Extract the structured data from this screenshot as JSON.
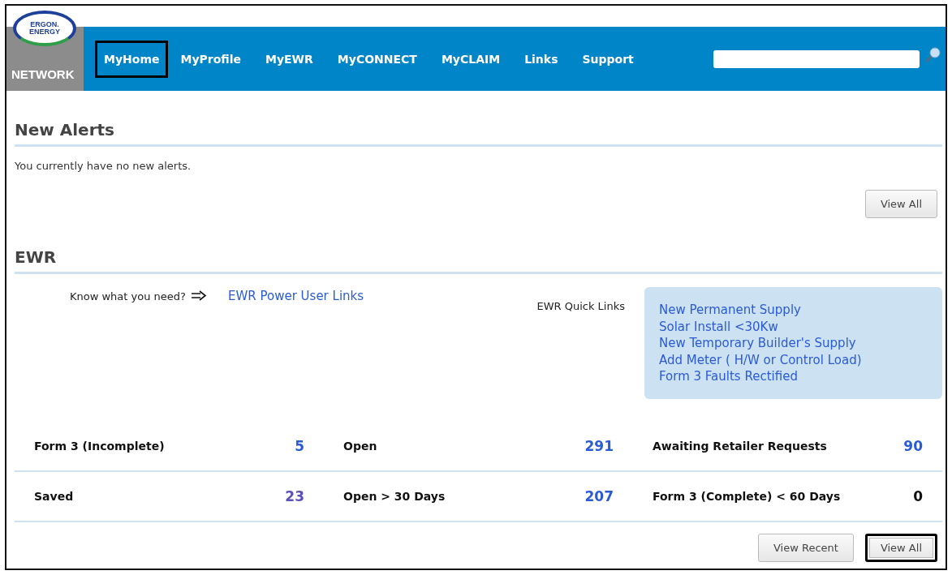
{
  "logo": {
    "lines": [
      "ERGON.",
      "ENERGY"
    ],
    "caption": "NETWORK"
  },
  "nav": [
    {
      "label": "MyHome",
      "highlighted": true
    },
    {
      "label": "MyProfile",
      "highlighted": false
    },
    {
      "label": "MyEWR",
      "highlighted": false
    },
    {
      "label": "MyCONNECT",
      "highlighted": false
    },
    {
      "label": "MyCLAIM",
      "highlighted": false
    },
    {
      "label": "Links",
      "highlighted": false
    },
    {
      "label": "Support",
      "highlighted": false
    }
  ],
  "alerts": {
    "title": "New Alerts",
    "message": "You currently have no new alerts.",
    "buttons": [
      {
        "label": "View All",
        "highlighted": false
      }
    ]
  },
  "ewr": {
    "title": "EWR",
    "prompt": "Know what you need?",
    "power_link": "EWR Power User Links",
    "quick_links_label": "EWR Quick Links",
    "quick_links": [
      "New Permanent Supply",
      "Solar Install <30Kw",
      "New Temporary Builder's Supply",
      "Add Meter ( H/W or Control Load)",
      "Form 3 Faults Rectified"
    ],
    "stats": [
      [
        {
          "label": "Form 3 (Incomplete)",
          "count": "5",
          "color": "#2a5bd7"
        },
        {
          "label": "Open",
          "count": "291",
          "color": "#2a5bd7"
        },
        {
          "label": "Awaiting Retailer Requests",
          "count": "90",
          "color": "#2a5bd7"
        }
      ],
      [
        {
          "label": "Saved",
          "count": "23",
          "color": "#5a4fb8"
        },
        {
          "label": "Open > 30 Days",
          "count": "207",
          "color": "#2a5bd7"
        },
        {
          "label": "Form 3 (Complete) < 60 Days",
          "count": "0",
          "color": "#111111"
        }
      ]
    ],
    "buttons": [
      {
        "label": "View Recent",
        "highlighted": false
      },
      {
        "label": "View All",
        "highlighted": true
      }
    ]
  }
}
